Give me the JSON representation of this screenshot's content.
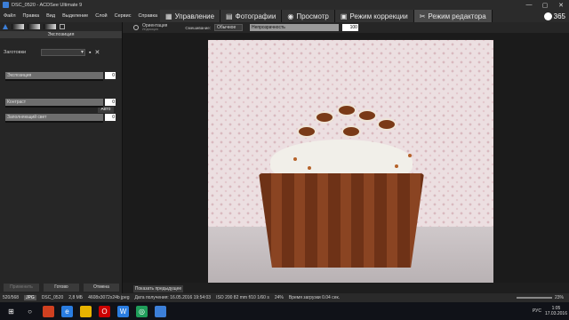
{
  "window": {
    "title": "DSC_0520 - ACDSee Ultimate 9"
  },
  "menu": [
    "Файл",
    "Правка",
    "Вид",
    "Выделение",
    "Слой",
    "Сервис",
    "Справка"
  ],
  "mode_tabs": [
    {
      "label": "Управление",
      "icon": "grid-icon",
      "active": false
    },
    {
      "label": "Фотографии",
      "icon": "photos-icon",
      "active": false
    },
    {
      "label": "Просмотр",
      "icon": "eye-icon",
      "active": false
    },
    {
      "label": "Режим коррекции",
      "icon": "develop-icon",
      "active": false
    },
    {
      "label": "Режим редактора",
      "icon": "edit-tools-icon",
      "active": true
    }
  ],
  "tab365": "365",
  "panel": {
    "section": "Экспозиция",
    "presets_label": "Заготовки",
    "sliders": [
      {
        "label": "Экспозиция",
        "value": "0"
      },
      {
        "label": "Контраст",
        "value": "0"
      },
      {
        "label": "Заполняющий свет",
        "value": "0"
      }
    ],
    "auto_label": "Авто",
    "apply_label": "Применить",
    "done_label": "Готово",
    "cancel_label": "Отмена"
  },
  "subtoolbar": {
    "orientation": "Ориентация",
    "orientation_sub": "Индикация",
    "blend_label": "Смешивание:",
    "blend_value": "Обычное",
    "opacity_label": "Непрозрачность",
    "opacity_value": "100"
  },
  "show_prev_label": "Показать предыдущее",
  "status": {
    "index": "520/568",
    "format": "JPG",
    "filename": "DSC_0520",
    "size": "2,8 МБ",
    "dimensions": "4608x3072x24b jpeg",
    "date": "Дата получения: 16.05.2016 19:54:03",
    "exif": "ISO 200   82 mm   f/10   1/60 s",
    "zoom_pct": "24%",
    "load_time": "Время загрузки 0.04 сек.",
    "zoom_display": "23%"
  },
  "tray": {
    "lang": "РУС",
    "time": "1:05",
    "date": "17.03.2016"
  }
}
